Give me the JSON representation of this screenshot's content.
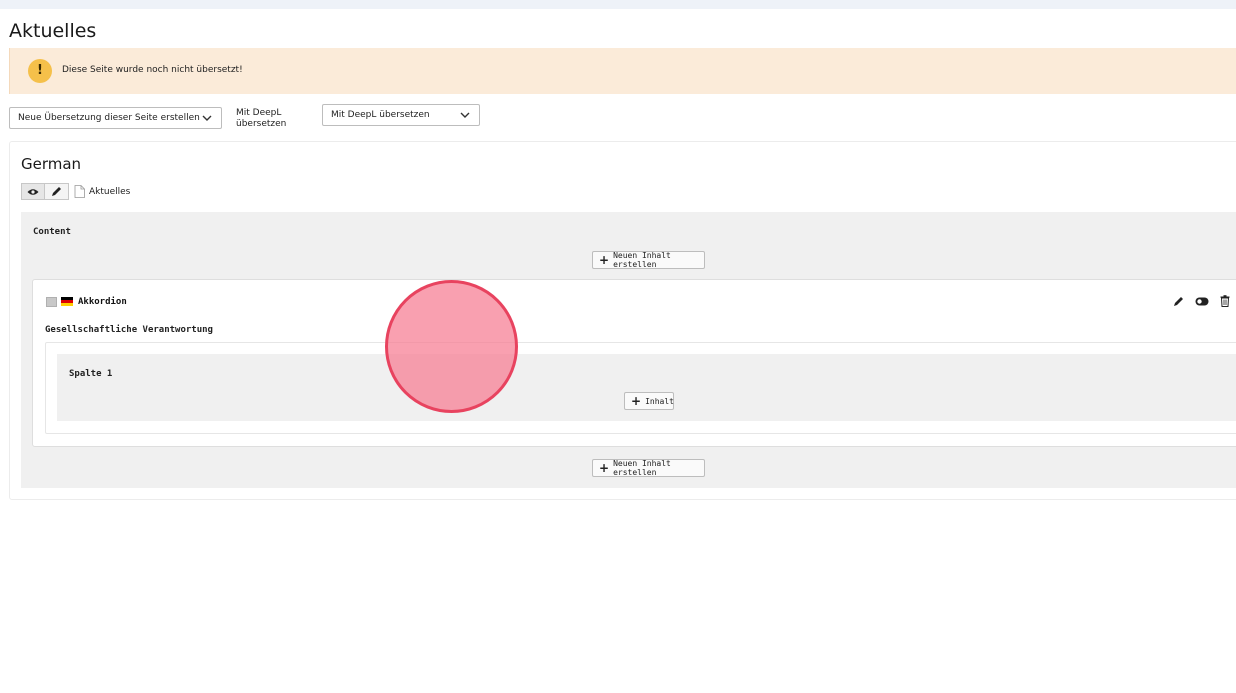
{
  "page": {
    "title": "Aktuelles"
  },
  "notice": {
    "icon": "exclamation-icon",
    "text": "Diese Seite wurde noch nicht übersetzt!",
    "background": "#fbebd9",
    "icon_color": "#f5c04a"
  },
  "translation": {
    "new_translation_select": "Neue Übersetzung dieser Seite erstellen",
    "deepl_label": "Mit DeepL übersetzen",
    "deepl_select": "Mit DeepL übersetzen"
  },
  "language_block": {
    "title": "German",
    "buttons": [
      "eye-icon",
      "pencil-icon"
    ],
    "page_icon": "page-file-icon",
    "page_name": "Aktuelles"
  },
  "content": {
    "label": "Content",
    "new_content_button": "Neuen Inhalt erstellen",
    "element": {
      "flag": "german-flag-icon",
      "title": "Akkordion",
      "subtitle": "Gesellschaftliche Verantwortung",
      "actions": [
        "pencil-icon",
        "toggle-icon",
        "trash-icon"
      ],
      "column": {
        "label": "Spalte 1",
        "add_button": "Inhalt"
      }
    },
    "new_content_button_bottom": "Neuen Inhalt erstellen"
  },
  "colors": {
    "flag_black": "#000000",
    "flag_red": "#dd0000",
    "flag_gold": "#ffce00",
    "cursor_fill": "#f77c91",
    "cursor_border": "#e8435f"
  }
}
